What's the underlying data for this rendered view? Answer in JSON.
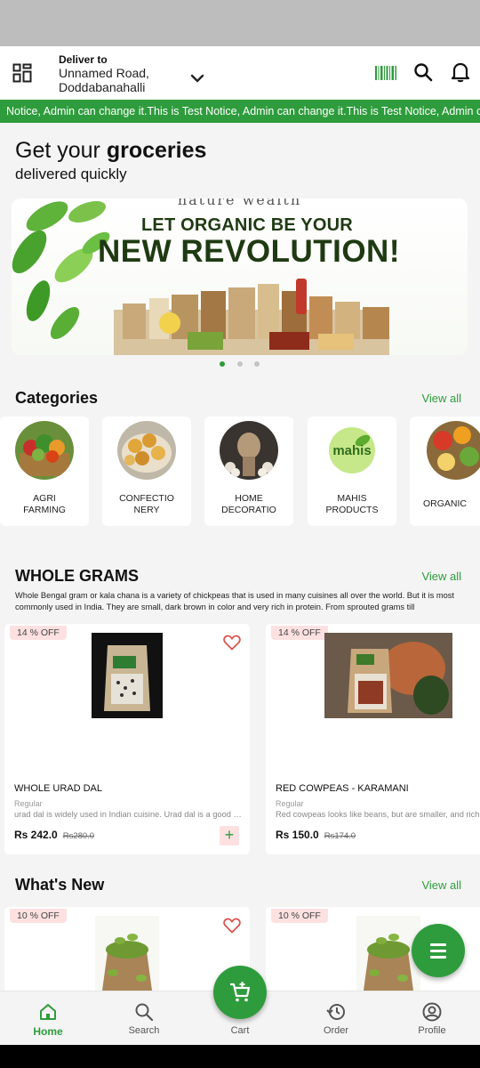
{
  "header": {
    "deliver_label": "Deliver to",
    "address_line1": "Unnamed Road,",
    "address_line2": "Doddabanahalli",
    "icons": [
      "grid-menu-icon",
      "chevron-down-icon",
      "barcode-icon",
      "search-icon",
      "bell-icon"
    ]
  },
  "notice": {
    "text": "Notice, Admin can change it.This is Test Notice, Admin can change it.This is Test Notice, Admin can change it.This is Test Notice, Admin can change it."
  },
  "hero": {
    "title_plain": "Get your ",
    "title_bold": "groceries",
    "subtitle": "delivered quickly"
  },
  "banner": {
    "brand": "nature wealth",
    "line1": "LET ORGANIC BE YOUR",
    "line2": "NEW REVOLUTION!",
    "slide_count": 3,
    "active_slide": 1
  },
  "categories": {
    "title": "Categories",
    "view_all": "View all",
    "items": [
      {
        "line1": "AGRI",
        "line2": "FARMING"
      },
      {
        "line1": "CONFECTIO",
        "line2": "NERY"
      },
      {
        "line1": "HOME",
        "line2": "DECORATIO"
      },
      {
        "line1": "MAHIS",
        "line2": "PRODUCTS",
        "logo_text": "mahis"
      },
      {
        "line1": "ORGANIC",
        "line2": ""
      }
    ]
  },
  "whole_grams": {
    "title": "WHOLE GRAMS",
    "view_all": "View all",
    "description": "Whole Bengal gram or kala chana is a variety of chickpeas that is used in many cuisines all over the world. But it is most commonly used in India. They are small, dark brown in color and very rich in protein. From sprouted grams till",
    "products": [
      {
        "badge": "14 % OFF",
        "name": "WHOLE URAD DAL",
        "unit": "Regular",
        "desc": "urad dal is widely used in Indian cuisine. Urad dal is a good source of protein",
        "price": "Rs 242.0",
        "old_price": "Rs280.0",
        "add": "+"
      },
      {
        "badge": "14 % OFF",
        "name": "RED COWPEAS - KARAMANI",
        "unit": "Regular",
        "desc": "Red cowpeas looks like beans, but are smaller, and rich in protein",
        "price": "Rs 150.0",
        "old_price": "Rs174.0"
      }
    ]
  },
  "whats_new": {
    "title": "What's New",
    "view_all": "View all",
    "products": [
      {
        "badge": "10 % OFF"
      },
      {
        "badge": "10 % OFF"
      }
    ]
  },
  "bottom_nav": {
    "items": [
      {
        "label": "Home",
        "icon": "home-icon",
        "active": true
      },
      {
        "label": "Search",
        "icon": "search-icon"
      },
      {
        "label": "Cart",
        "icon": "cart-icon"
      },
      {
        "label": "Order",
        "icon": "history-icon"
      },
      {
        "label": "Profile",
        "icon": "profile-icon"
      }
    ]
  },
  "colors": {
    "brand_green": "#2e9c3c",
    "badge_pink": "#fde1e1",
    "heart_red": "#d9534f"
  }
}
